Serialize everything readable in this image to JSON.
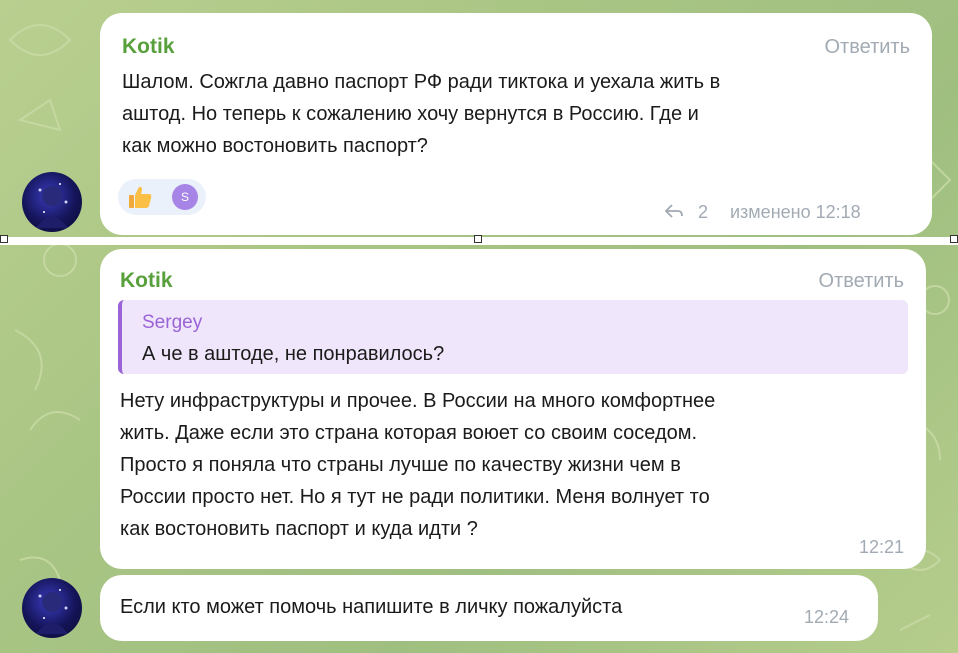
{
  "messages": [
    {
      "sender": "Kotik",
      "reply_label": "Ответить",
      "lines": [
        "Шалом. Сожгла давно паспорт РФ ради тиктока и  уехала жить в",
        "аштод. Но теперь к сожалению хочу вернутся в Россию. Где и",
        "как можно востоновить паспорт?"
      ],
      "reactions": [
        {
          "icon": "thumbs-up-icon"
        },
        {
          "icon": "avatar-badge",
          "letter": "S"
        }
      ],
      "reply_count": "2",
      "edited_label": "изменено 12:18"
    },
    {
      "sender": "Kotik",
      "reply_label": "Ответить",
      "quote": {
        "name": "Sergey",
        "text": "А че в аштоде, не понравилось?"
      },
      "lines": [
        "Нету инфраструктуры и прочее. В России на много комфортнее",
        "жить. Даже если это страна которая воюет со своим соседом.",
        "Просто я поняла что страны лучше по качеству жизни чем в",
        "России просто нет. Но я тут не ради политики. Меня волнует то",
        "как востоновить паспорт и куда идти ?"
      ],
      "time": "12:21"
    },
    {
      "text": "Если кто может помочь напишите в личку пожалуйста",
      "time": "12:24"
    }
  ],
  "colors": {
    "sender": "#57a03b",
    "quote_accent": "#9a63d6",
    "meta": "#a2aab3",
    "background": "#a9c584"
  }
}
